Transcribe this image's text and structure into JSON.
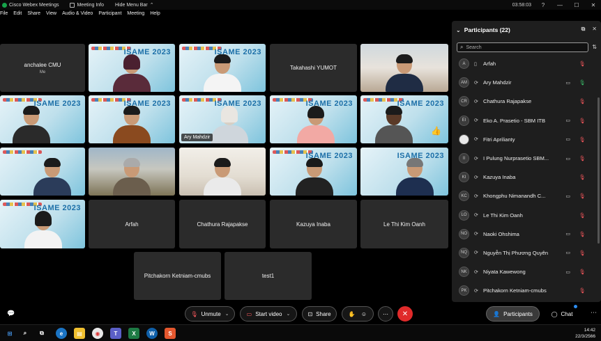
{
  "titlebar": {
    "app_title": "Cisco Webex Meetings",
    "meeting_info": "Meeting Info",
    "hide_menu": "Hide Menu Bar",
    "timer": "03:58:03",
    "min": "—",
    "max": "☐",
    "close": "✕"
  },
  "menu": [
    "File",
    "Edit",
    "Share",
    "View",
    "Audio & Video",
    "Participant",
    "Meeting",
    "Help"
  ],
  "tiles": {
    "t1": {
      "name": "anchalee CMU",
      "sub": "Me"
    },
    "t4": {
      "name": "Takahashi YUMOT"
    },
    "t12_label": "Ary Mahdzir",
    "t17": {
      "name": "Arfah"
    },
    "t18": {
      "name": "Chathura Rajapakse"
    },
    "t19": {
      "name": "Kazuya Inaba"
    },
    "t20": {
      "name": "Le Thi Kim Oanh"
    },
    "t21": {
      "name": "Pitchakorn Ketniam-cmubs"
    },
    "t22": {
      "name": "test1"
    },
    "banner": "ISAME 2023"
  },
  "panel": {
    "title": "Participants (22)",
    "search_placeholder": "Search",
    "participants": [
      {
        "initials": "A",
        "name": "Arfah",
        "mic": "muted",
        "cam": false,
        "dev": "phone"
      },
      {
        "initials": "AM",
        "name": "Ary Mahdzir",
        "mic": "on",
        "cam": true,
        "dev": "pc"
      },
      {
        "initials": "CR",
        "name": "Chathura Rajapakse",
        "mic": "muted",
        "cam": false,
        "dev": "pc"
      },
      {
        "initials": "EI",
        "name": "Eko A. Prasetio - SBM ITB",
        "mic": "muted",
        "cam": true,
        "dev": "pc"
      },
      {
        "initials": "",
        "name": "Fitri Aprilianty",
        "mic": "muted",
        "cam": true,
        "dev": "pc"
      },
      {
        "initials": "II",
        "name": "I Pulung Nurprasetio SBM...",
        "mic": "muted",
        "cam": true,
        "dev": "pc"
      },
      {
        "initials": "KI",
        "name": "Kazuya Inaba",
        "mic": "muted",
        "cam": false,
        "dev": "pc"
      },
      {
        "initials": "KC",
        "name": "Khongphu Nimanandh C...",
        "mic": "muted",
        "cam": true,
        "dev": "pc"
      },
      {
        "initials": "LO",
        "name": "Le Thi Kim Oanh",
        "mic": "muted",
        "cam": false,
        "dev": "pc"
      },
      {
        "initials": "NO",
        "name": "Naoki Ohshima",
        "mic": "muted",
        "cam": true,
        "dev": "pc"
      },
      {
        "initials": "NQ",
        "name": "Nguyễn Thị Phương Quyên",
        "mic": "muted",
        "cam": true,
        "dev": "pc"
      },
      {
        "initials": "NK",
        "name": "Niyata Kawewong",
        "mic": "muted",
        "cam": true,
        "dev": "pc"
      },
      {
        "initials": "PK",
        "name": "Pitchakorn Ketniam-cmubs",
        "mic": "muted",
        "cam": false,
        "dev": "pc"
      }
    ]
  },
  "controls": {
    "unmute": "Unmute",
    "start_video": "Start video",
    "share": "Share",
    "participants": "Participants",
    "chat": "Chat"
  },
  "taskbar": {
    "time": "14:42",
    "date": "22/3/2566"
  },
  "colors": {
    "muted_mic": "#ff5a5f",
    "active_mic": "#3bbf6a",
    "leave": "#e02a2a",
    "panel_bg": "#1e1e1e"
  }
}
